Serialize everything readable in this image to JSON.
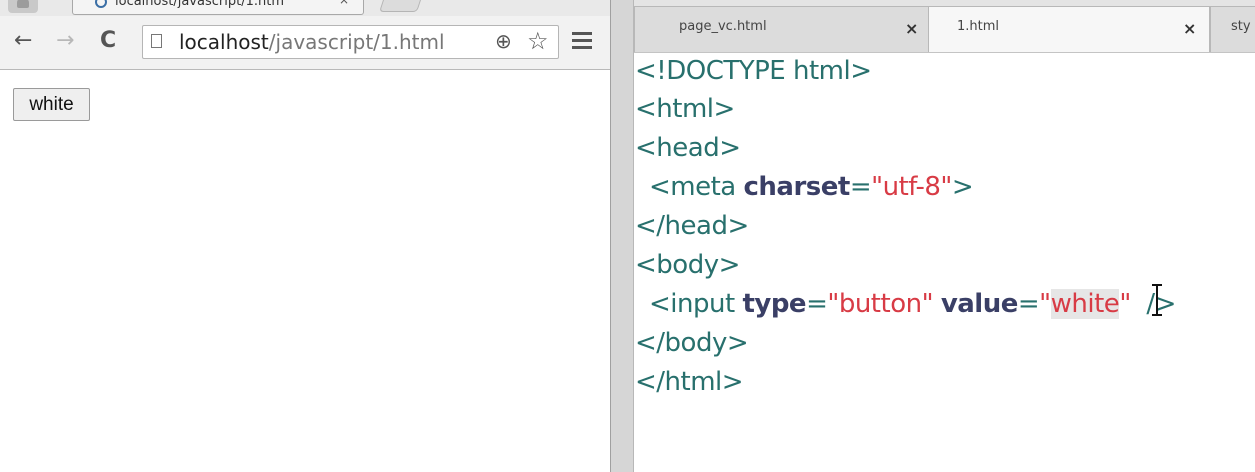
{
  "browser": {
    "tab_title": "localhost/javascript/1.htm",
    "tab_close": "×",
    "url_host": "localhost",
    "url_path": "/javascript/1.html",
    "back_icon": "←",
    "forward_icon": "→",
    "reload_icon": "C",
    "zoom_icon": "⊕",
    "star_icon": "☆",
    "page_button_label": "white"
  },
  "editor": {
    "tabs": [
      {
        "label": "page_vc.html",
        "close": "×"
      },
      {
        "label": "1.html",
        "close": "×"
      },
      {
        "label": "sty"
      }
    ],
    "code": {
      "l1": "<!DOCTYPE html>",
      "l2": "<html>",
      "l3": "<head>",
      "l4_tag": "<meta ",
      "l4_attr": "charset",
      "l4_eq": "=",
      "l4_val": "\"utf-8\"",
      "l4_end": ">",
      "l5": "</head>",
      "l6": "<body>",
      "l7_tag": "<input ",
      "l7_attr1": "type",
      "l7_eq1": "=",
      "l7_val1": "\"button\"",
      "l7_attr2": "value",
      "l7_eq2": "=",
      "l7_q1": "\"",
      "l7_val2": "white",
      "l7_q2": "\"",
      "l7_end": "/>",
      "l8": "</body>",
      "l9": "</html>"
    }
  }
}
